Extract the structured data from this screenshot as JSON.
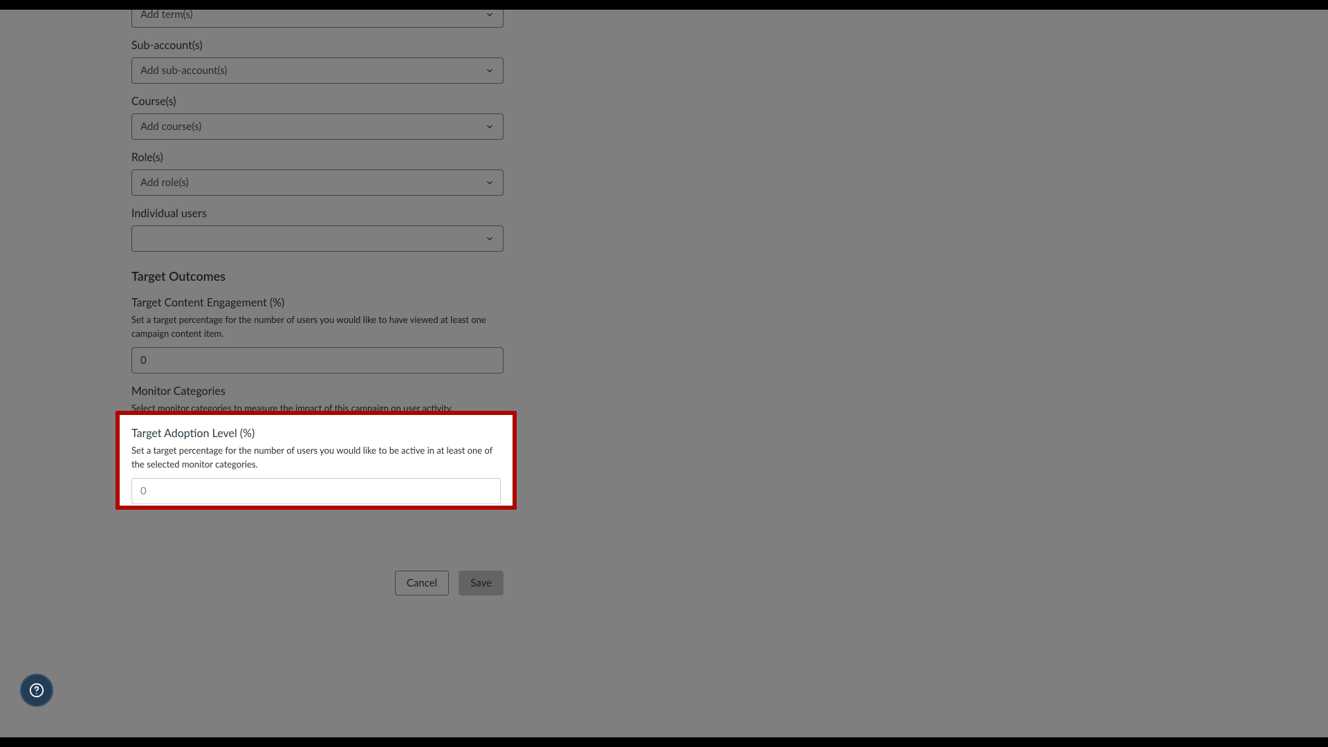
{
  "fields": {
    "terms": {
      "placeholder": "Add term(s)"
    },
    "sub_accounts": {
      "label": "Sub-account(s)",
      "placeholder": "Add sub-account(s)"
    },
    "courses": {
      "label": "Course(s)",
      "placeholder": "Add course(s)"
    },
    "roles": {
      "label": "Role(s)",
      "placeholder": "Add role(s)"
    },
    "individual_users": {
      "label": "Individual users",
      "placeholder": ""
    }
  },
  "target_outcomes": {
    "heading": "Target Outcomes",
    "content_engagement": {
      "label": "Target Content Engagement (%)",
      "help": "Set a target percentage for the number of users you would like to have viewed at least one campaign content item.",
      "value": "0"
    },
    "monitor_categories": {
      "label": "Monitor Categories",
      "help": "Select monitor categories to measure the impact of this campaign on user activity."
    },
    "adoption_level": {
      "label": "Target Adoption Level (%)",
      "help": "Set a target percentage for the number of users you would like to be active in at least one of the selected monitor categories.",
      "placeholder": "0"
    }
  },
  "buttons": {
    "cancel": "Cancel",
    "save": "Save"
  }
}
